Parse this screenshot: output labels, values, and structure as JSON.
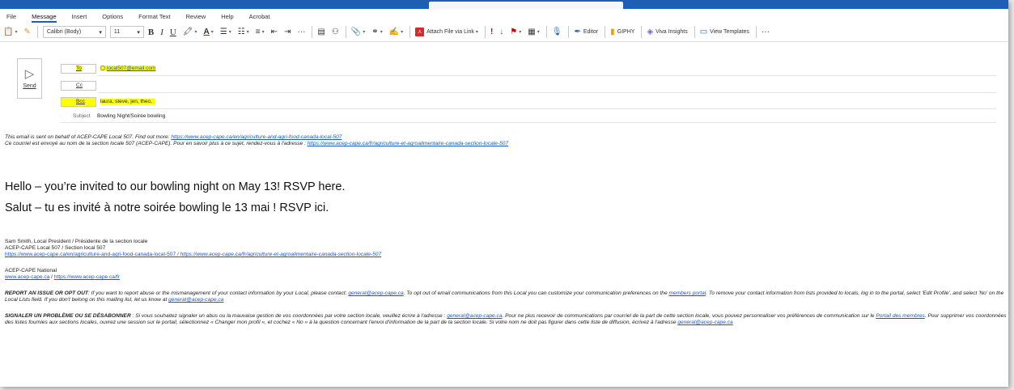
{
  "menu": {
    "items": [
      "File",
      "Message",
      "Insert",
      "Options",
      "Format Text",
      "Review",
      "Help",
      "Acrobat"
    ],
    "active": "Message"
  },
  "ribbon": {
    "font_name": "Calibri (Body)",
    "font_size": "11",
    "attach_label": "Attach File via Link",
    "editor_label": "Editor",
    "giphy_label": "GIPHY",
    "viva_label": "Viva Insights",
    "templates_label": "View Templates",
    "more_label": "···",
    "bold_glyph": "B",
    "italic_glyph": "I",
    "underline_glyph": "U"
  },
  "compose": {
    "send_label": "Send",
    "to_label": "To",
    "to_value": "local507@email.com",
    "cc_label": "Cc",
    "bcc_label": "Bcc",
    "bcc_value": "laura, steve, jen, theo,",
    "subject_label": "Subject",
    "subject_value": "Bowling Night/Soirée bowling"
  },
  "message": {
    "intro_en_text": "This email is sent on behalf of ACEP-CAPE Local 507. Find out more: ",
    "intro_en_link": "https://www.acep-cape.ca/en/agriculture-and-agri-food-canada-local-507",
    "intro_fr_text": "Ce courriel est envoyé au nom de la section locale 507 (ACEP-CAPE). Pour en savoir plus à ce sujet, rendez-vous à l'adresse : ",
    "intro_fr_link": "https://www.acep-cape.ca/fr/agriculture-et-agroalimentaire-canada-section-locale-507",
    "greeting_en": "Hello – you’re invited to our bowling night on May 13! RSVP here.",
    "greeting_fr": "Salut – tu es invité à notre soirée bowling le 13 mai ! RSVP ici.",
    "sig_name": "Sam Smith, Local President / Présidente de la section locale",
    "sig_local": "ACEP-CAPE Local 507 / Section local 507",
    "sig_link_en": "https://www.acep-cape.ca/en/agriculture-and-agri-food-canada-local-507",
    "sig_link_sep": " / ",
    "sig_link_fr": "https://www.acep-cape.ca/fr/agriculture-et-agroalimentaire-canada-section-locale-507",
    "national_label": "ACEP-CAPE National",
    "national_link1": "www.acep-cape.ca",
    "national_sep": " / ",
    "national_link2": "https://www.acep-cape.ca/fr",
    "report_en_bold": "REPORT AN ISSUE OR OPT OUT",
    "report_en_t1": ": If you want to report abuse or the mismanagement of your contact information by your Local, please contact: ",
    "report_en_email": "general@acep-cape.ca",
    "report_en_t2": ". To opt out of email communications from this Local you can customize your communication preferences on the ",
    "report_en_portal": "members portal",
    "report_en_t3": ". To remove your contact information from lists provided to locals, log in to the portal, select 'Edit Profile', and select 'No' on the Local Lists field. If you don't belong on this mailing list, let us know at ",
    "report_en_email2": "general@acep-cape.ca",
    "report_fr_bold": "SIGNALER UN PROBLÈME OU SE DÉSABONNER",
    "report_fr_t1": " : Si vous souhaitez signaler un abus ou la mauvaise gestion de vos coordonnées par votre section locale, veuillez écrire à l'adresse : ",
    "report_fr_email": "general@acep-cape.ca",
    "report_fr_t2": ". Pour ne plus recevoir de communications par courriel de la part de cette section locale, vous pouvez personnaliser vos préférences de communication sur le ",
    "report_fr_portal": "Portail des membres",
    "report_fr_t3": ". Pour supprimer vos coordonnées des listes fournies aux sections locales, ouvrez une session sur le portail, sélectionnez « Changer mon profil », et cochez « No » à la question concernant l'envoi d'information de la part de la section locale. Si votre nom ne doit pas figurer dans cette liste de diffusion, écrivez à l'adresse ",
    "report_fr_email2": "general@acep-cape.ca"
  },
  "colors": {
    "accent": "#1e5fb4",
    "highlight": "#ffff00",
    "link": "#1a56c4"
  }
}
